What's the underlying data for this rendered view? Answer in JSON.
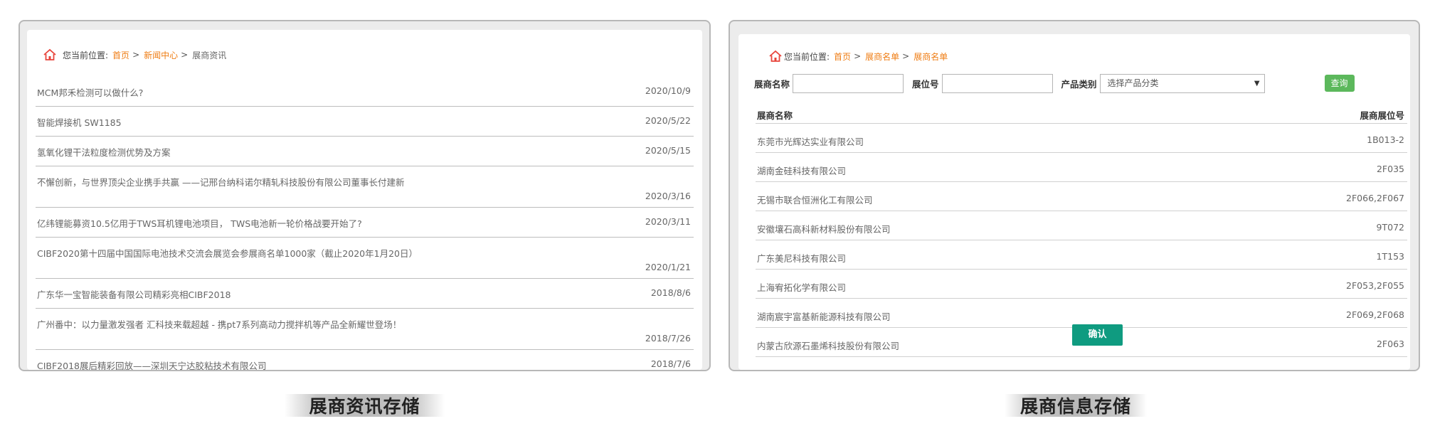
{
  "left_panel": {
    "breadcrumb": {
      "prefix": "您当前位置:",
      "links": [
        "首页",
        "新闻中心"
      ],
      "separator": ">",
      "current": "展商资讯"
    },
    "news": [
      {
        "title": "MCM邦禾检测可以做什么?",
        "date": "2020/10/9",
        "wrap": false
      },
      {
        "title": "智能焊接机 SW1185",
        "date": "2020/5/22",
        "wrap": false
      },
      {
        "title": "氢氧化锂干法粒度检测优势及方案",
        "date": "2020/5/15",
        "wrap": false
      },
      {
        "title": "不懈创新，与世界顶尖企业携手共赢 ——记邢台纳科诺尔精轧科技股份有限公司董事长付建新",
        "date": "2020/3/16",
        "wrap": true
      },
      {
        "title": "亿纬锂能募资10.5亿用于TWS耳机锂电池项目， TWS电池新一轮价格战要开始了?",
        "date": "2020/3/11",
        "wrap": false
      },
      {
        "title": "CIBF2020第十四届中国国际电池技术交流会展览会参展商名单1000家（截止2020年1月20日）",
        "date": "2020/1/21",
        "wrap": true
      },
      {
        "title": "广东华一宝智能装备有限公司精彩亮相CIBF2018",
        "date": "2018/8/6",
        "wrap": false
      },
      {
        "title": "广州番中：以力量激发强者 汇科技来载超越 - 携pt7系列高动力搅拌机等产品全新耀世登场！",
        "date": "2018/7/26",
        "wrap": true
      },
      {
        "title": "CIBF2018展后精彩回放——深圳天宁达胶粘技术有限公司",
        "date": "2018/7/6",
        "wrap": false
      }
    ]
  },
  "right_panel": {
    "breadcrumb": {
      "prefix": "您当前位置:",
      "links": [
        "首页",
        "展商名单"
      ],
      "separator": ">",
      "current": "展商名单"
    },
    "form": {
      "name_label": "展商名称",
      "booth_label": "展位号",
      "category_label": "产品类别",
      "category_selected": "选择产品分类",
      "query_label": "查询"
    },
    "table": {
      "columns": [
        "展商名称",
        "展商展位号"
      ],
      "rows": [
        {
          "name": "东莞市光辉达实业有限公司",
          "booth": "1B013-2"
        },
        {
          "name": "湖南金硅科技有限公司",
          "booth": "2F035"
        },
        {
          "name": "无锡市联合恒洲化工有限公司",
          "booth": "2F066,2F067"
        },
        {
          "name": "安徽壤石高科新材料股份有限公司",
          "booth": "9T072"
        },
        {
          "name": "广东美尼科技有限公司",
          "booth": "1T153"
        },
        {
          "name": "上海宥拓化学有限公司",
          "booth": "2F053,2F055"
        },
        {
          "name": "湖南宸宇富基新能源科技有限公司",
          "booth": "2F069,2F068"
        },
        {
          "name": "内蒙古欣源石墨烯科技股份有限公司",
          "booth": "2F063"
        }
      ]
    },
    "confirm_label": "确认"
  },
  "captions": {
    "left": "展商资讯存储",
    "right": "展商信息存储"
  },
  "colors": {
    "link": "#ef7d14",
    "home_icon": "#e8453c",
    "query_button": "#5cb85c",
    "confirm_button": "#0f9b80"
  }
}
